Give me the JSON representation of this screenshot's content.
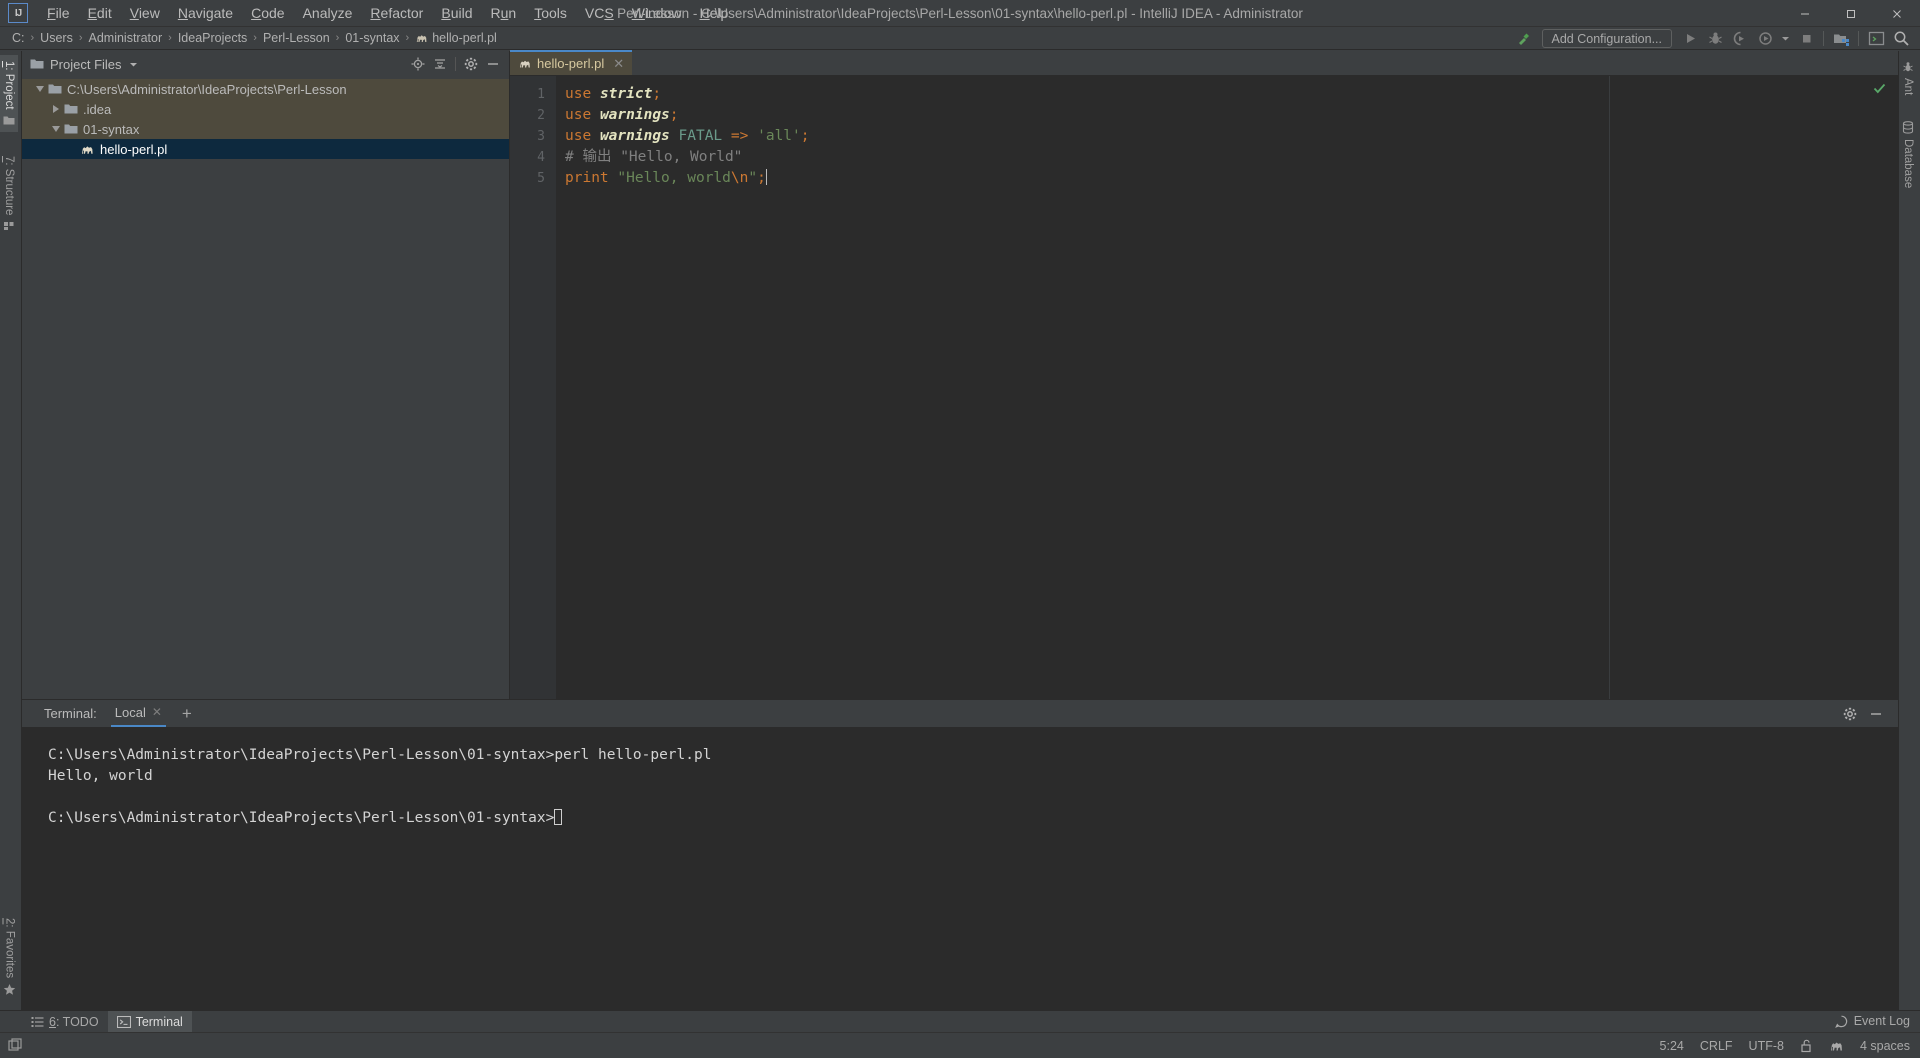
{
  "window": {
    "title": "Perl-Lesson - C:\\Users\\Administrator\\IdeaProjects\\Perl-Lesson\\01-syntax\\hello-perl.pl - IntelliJ IDEA - Administrator",
    "logo_text": "IJ",
    "minimize": "–",
    "maximize": "❐",
    "close": "✕"
  },
  "menu": {
    "items": [
      {
        "label": "File",
        "mnemonic": "F"
      },
      {
        "label": "Edit",
        "mnemonic": "E"
      },
      {
        "label": "View",
        "mnemonic": "V"
      },
      {
        "label": "Navigate",
        "mnemonic": "N"
      },
      {
        "label": "Code",
        "mnemonic": "C"
      },
      {
        "label": "Analyze",
        "mnemonic": ""
      },
      {
        "label": "Refactor",
        "mnemonic": "R"
      },
      {
        "label": "Build",
        "mnemonic": "B"
      },
      {
        "label": "Run",
        "mnemonic": "u"
      },
      {
        "label": "Tools",
        "mnemonic": "T"
      },
      {
        "label": "VCS",
        "mnemonic": "S"
      },
      {
        "label": "Window",
        "mnemonic": "W"
      },
      {
        "label": "Help",
        "mnemonic": "H"
      }
    ]
  },
  "breadcrumb": {
    "items": [
      "C:",
      "Users",
      "Administrator",
      "IdeaProjects",
      "Perl-Lesson",
      "01-syntax",
      "hello-perl.pl"
    ],
    "separator": "›"
  },
  "toolbar": {
    "build_icon": "hammer-icon",
    "add_configuration": "Add Configuration...",
    "run_icon": "run-icon",
    "debug_icon": "debug-icon",
    "run_coverage_icon": "run-with-coverage-icon",
    "profile_icon": "profiler-icon",
    "dropdown_icon": "chevron-down-icon",
    "stop_icon": "stop-icon",
    "project_structure_icon": "project-structure-icon",
    "terminal_icon": "terminal-icon",
    "search_icon": "search-icon"
  },
  "left_strip": {
    "project": {
      "label": "1: Project",
      "mnemonic": "1",
      "icon": "project-folder-icon",
      "active": true
    },
    "structure": {
      "label": "7: Structure",
      "mnemonic": "7",
      "icon": "structure-icon",
      "active": false
    },
    "favorites": {
      "label": "2: Favorites",
      "mnemonic": "2",
      "icon": "star-icon",
      "active": false
    }
  },
  "right_strip": {
    "ant": {
      "label": "Ant",
      "icon": "ant-icon"
    },
    "database": {
      "label": "Database",
      "icon": "database-icon"
    }
  },
  "project_panel": {
    "title": "Project Files",
    "dropdown_icon": "chevron-down-icon",
    "folder_icon": "folder-icon",
    "actions": [
      {
        "name": "locate-icon",
        "glyph": "⊕"
      },
      {
        "name": "collapse-all-icon",
        "glyph": "≡"
      },
      {
        "name": "settings-gear-icon",
        "glyph": "⚙"
      },
      {
        "name": "hide-panel-icon",
        "glyph": "—"
      }
    ],
    "tree": [
      {
        "label": "C:\\Users\\Administrator\\IdeaProjects\\Perl-Lesson",
        "depth": 0,
        "expanded": true,
        "icon": "folder-icon",
        "state": "highlight"
      },
      {
        "label": ".idea",
        "depth": 1,
        "expanded": false,
        "icon": "folder-icon",
        "state": "highlight"
      },
      {
        "label": "01-syntax",
        "depth": 1,
        "expanded": true,
        "icon": "folder-icon",
        "state": "highlight"
      },
      {
        "label": "hello-perl.pl",
        "depth": 2,
        "expanded": null,
        "icon": "perl-camel-icon",
        "state": "selected"
      }
    ]
  },
  "editor": {
    "tab": {
      "label": "hello-perl.pl",
      "icon": "perl-camel-icon",
      "close": "✕"
    },
    "inspection_ok_icon": "check-icon",
    "line_numbers": [
      "1",
      "2",
      "3",
      "4",
      "5"
    ],
    "code_lines": [
      [
        {
          "t": "use",
          "c": "k-use"
        },
        {
          "t": " ",
          "c": "k-plain"
        },
        {
          "t": "strict",
          "c": "k-mod"
        },
        {
          "t": ";",
          "c": "k-punc"
        }
      ],
      [
        {
          "t": "use",
          "c": "k-use"
        },
        {
          "t": " ",
          "c": "k-plain"
        },
        {
          "t": "warnings",
          "c": "k-mod"
        },
        {
          "t": ";",
          "c": "k-punc"
        }
      ],
      [
        {
          "t": "use",
          "c": "k-use"
        },
        {
          "t": " ",
          "c": "k-plain"
        },
        {
          "t": "warnings",
          "c": "k-mod"
        },
        {
          "t": " ",
          "c": "k-plain"
        },
        {
          "t": "FATAL",
          "c": "k-const"
        },
        {
          "t": " ",
          "c": "k-plain"
        },
        {
          "t": "=>",
          "c": "k-punc"
        },
        {
          "t": " ",
          "c": "k-plain"
        },
        {
          "t": "'all'",
          "c": "k-str"
        },
        {
          "t": ";",
          "c": "k-punc"
        }
      ],
      [
        {
          "t": "# 输出 \"Hello, World\"",
          "c": "k-com"
        }
      ],
      [
        {
          "t": "print",
          "c": "k-print"
        },
        {
          "t": " ",
          "c": "k-plain"
        },
        {
          "t": "\"Hello, world",
          "c": "k-str"
        },
        {
          "t": "\\n",
          "c": "k-esc"
        },
        {
          "t": "\"",
          "c": "k-str"
        },
        {
          "t": ";",
          "c": "k-punc"
        }
      ]
    ]
  },
  "terminal": {
    "label": "Terminal:",
    "tab": "Local",
    "tab_close": "✕",
    "new_tab": "+",
    "actions": [
      {
        "name": "settings-gear-icon",
        "glyph": "⚙"
      },
      {
        "name": "hide-panel-icon",
        "glyph": "—"
      }
    ],
    "lines": [
      "C:\\Users\\Administrator\\IdeaProjects\\Perl-Lesson\\01-syntax>perl hello-perl.pl",
      "Hello, world",
      "",
      "C:\\Users\\Administrator\\IdeaProjects\\Perl-Lesson\\01-syntax>"
    ]
  },
  "bottom_bar": {
    "todo": {
      "label": "6: TODO",
      "mnemonic": "6",
      "icon": "todo-list-icon",
      "active": false
    },
    "terminal": {
      "label": "Terminal",
      "icon": "terminal-icon",
      "active": true
    }
  },
  "event_log": {
    "label": "Event Log",
    "icon": "event-log-icon"
  },
  "status_bar": {
    "caret_position": "5:24",
    "line_separator": "CRLF",
    "encoding": "UTF-8",
    "lock_icon": "unlocked-padlock-icon",
    "language_icon": "perl-camel-icon",
    "indent": "4 spaces",
    "show_all_windows_icon": "windows-icon"
  },
  "colors": {
    "chrome": "#3c3f41",
    "editor_bg": "#2b2b2b",
    "gutter_bg": "#313335",
    "selection": "#0d293e",
    "tab_active": "#4e4a3d",
    "accent": "#4a88c7",
    "keyword_orange": "#cc7832",
    "string_green": "#6a8759",
    "comment_grey": "#808080",
    "text": "#a9b7c6",
    "ok_green": "#59a869"
  }
}
